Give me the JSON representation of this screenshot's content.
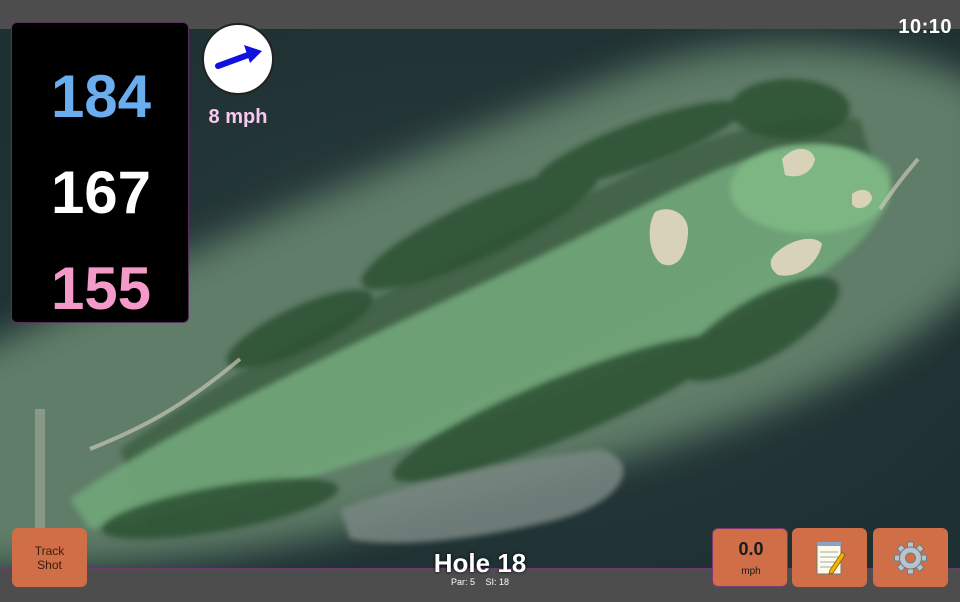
{
  "clock": "10:10",
  "distances": {
    "back": "184",
    "middle": "167",
    "front": "155"
  },
  "wind": {
    "speed_label": "8 mph",
    "direction_icon": "wind-arrow-icon"
  },
  "hole": {
    "title": "Hole 18",
    "par": "Par: 5",
    "stroke_index": "SI: 18"
  },
  "buttons": {
    "track_shot_line1": "Track",
    "track_shot_line2": "Shot",
    "speed_value": "0.0",
    "speed_unit": "mph",
    "notes_icon": "notepad-icon",
    "settings_icon": "gear-icon"
  },
  "colors": {
    "back_distance": "#6aaef0",
    "middle_distance": "#ffffff",
    "front_distance": "#f49ac8",
    "button_orange": "#cf6e47",
    "accent_purple": "#6b3a6e"
  }
}
